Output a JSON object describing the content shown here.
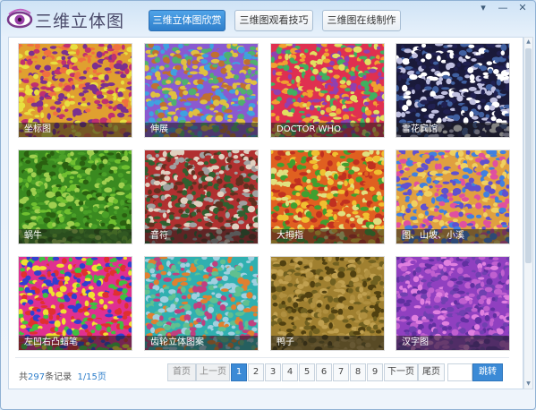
{
  "app": {
    "title": "三维立体图"
  },
  "tabs": [
    {
      "label": "三维立体图欣赏",
      "active": true
    },
    {
      "label": "三维图观看技巧",
      "active": false
    },
    {
      "label": "三维图在线制作",
      "active": false
    }
  ],
  "window_controls": {
    "menu": "▾",
    "minimize": "—",
    "close": "✕"
  },
  "gallery": [
    {
      "caption": "坐标图",
      "palette": [
        "#e0a030",
        "#c03070",
        "#e8e040",
        "#7a3090",
        "#f07040"
      ]
    },
    {
      "caption": "伸展",
      "palette": [
        "#8a5ad0",
        "#40a0e0",
        "#e0c040",
        "#c07030",
        "#50b070"
      ]
    },
    {
      "caption": "DOCTOR WHO",
      "palette": [
        "#e03050",
        "#40b060",
        "#f0a030",
        "#9040b0",
        "#e0e060"
      ]
    },
    {
      "caption": "雪花宾馆",
      "palette": [
        "#1a1a3a",
        "#ffffff",
        "#4060a0",
        "#c0c0e0",
        "#202050"
      ]
    },
    {
      "caption": "蜗牛",
      "palette": [
        "#3a8a20",
        "#70c030",
        "#2a6010",
        "#a0d050",
        "#4aa028"
      ]
    },
    {
      "caption": "音符",
      "palette": [
        "#b03030",
        "#e0d0c0",
        "#306030",
        "#a0a0a0",
        "#603020"
      ]
    },
    {
      "caption": "大拇指",
      "palette": [
        "#e06020",
        "#f0c030",
        "#40a030",
        "#c03020",
        "#e0e080"
      ]
    },
    {
      "caption": "图、山坡、小溪",
      "palette": [
        "#e0a040",
        "#6050d0",
        "#e050a0",
        "#4080e0",
        "#f0d060"
      ]
    },
    {
      "caption": "左凹右凸蜡笔",
      "palette": [
        "#e03090",
        "#40c040",
        "#f0e030",
        "#3040d0",
        "#e03030"
      ]
    },
    {
      "caption": "齿轮立体图案",
      "palette": [
        "#30b0b0",
        "#e08030",
        "#a0d0e0",
        "#c04080",
        "#60c090"
      ]
    },
    {
      "caption": "鸭子",
      "palette": [
        "#a08030",
        "#706020",
        "#c0a050",
        "#504010",
        "#b09040"
      ]
    },
    {
      "caption": "汉字图",
      "palette": [
        "#9040c0",
        "#c060d0",
        "#6030a0",
        "#e080e0",
        "#7040b0"
      ]
    }
  ],
  "pagination": {
    "prefix": "共",
    "total": "297",
    "suffix": "条记录",
    "page_info": "1/15页",
    "first": "首页",
    "prev": "上一页",
    "pages": [
      "1",
      "2",
      "3",
      "4",
      "5",
      "6",
      "7",
      "8",
      "9"
    ],
    "current_page": "1",
    "next": "下一页",
    "last": "尾页",
    "goto_value": "",
    "goto": "跳转"
  },
  "colors": {
    "accent": "#3b8ad6",
    "tab_active": "#3a8fd8",
    "caption_bg": "#1e1e1e"
  },
  "icons": {
    "logo": "eye-logo-icon"
  }
}
